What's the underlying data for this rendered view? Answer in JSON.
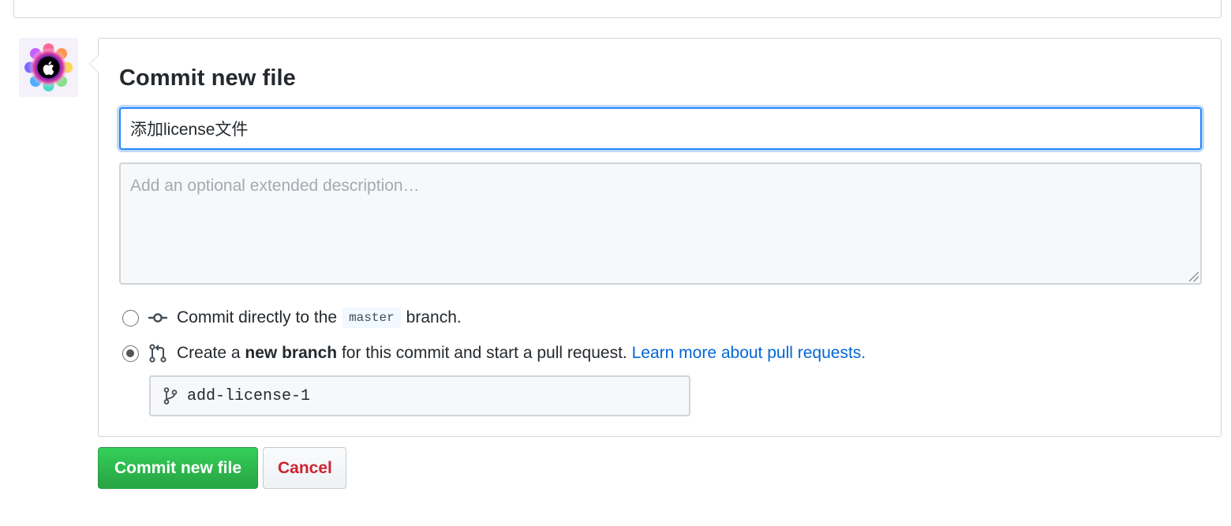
{
  "form": {
    "title": "Commit new file",
    "summary_value": "添加license文件",
    "description_placeholder": "Add an optional extended description…",
    "description_value": ""
  },
  "options": {
    "direct": {
      "selected": false,
      "text_before": "Commit directly to the",
      "branch_name": "master",
      "text_after": "branch."
    },
    "new_branch": {
      "selected": true,
      "text_before": "Create a",
      "bold_text": "new branch",
      "text_after": "for this commit and start a pull request.",
      "link_text": "Learn more about pull requests."
    }
  },
  "branch_input": {
    "value": "add-license-1"
  },
  "buttons": {
    "commit_label": "Commit new file",
    "cancel_label": "Cancel"
  },
  "colors": {
    "primary_green": "#28a745",
    "link_blue": "#0366d6",
    "focus_blue": "#2188ff",
    "cancel_red": "#cb2431"
  },
  "icons": {
    "commit_icon": "git-commit-icon",
    "pull_request_icon": "git-pull-request-icon",
    "branch_icon": "git-branch-icon",
    "avatar": "apple-logo-avatar"
  }
}
